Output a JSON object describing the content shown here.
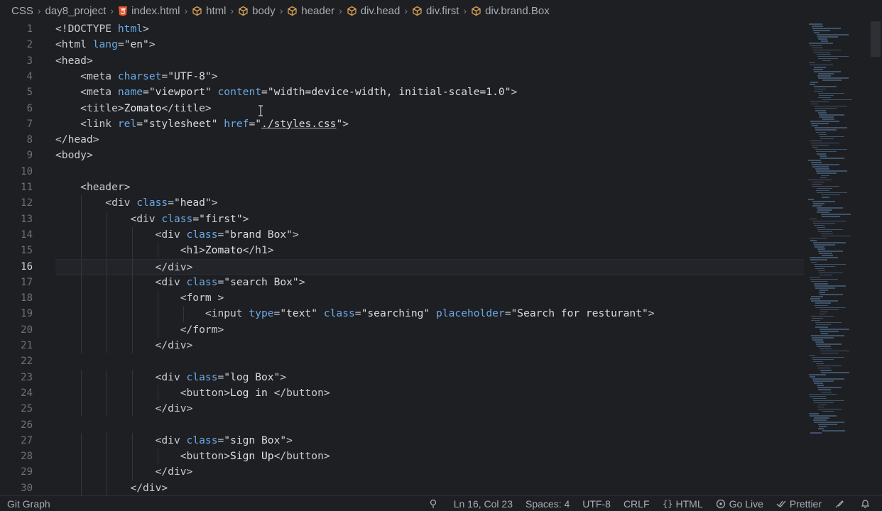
{
  "breadcrumb": {
    "items": [
      {
        "label": "CSS",
        "icon": ""
      },
      {
        "label": "day8_project",
        "icon": ""
      },
      {
        "label": "index.html",
        "icon": "html5-icon"
      },
      {
        "label": "html",
        "icon": "element-icon"
      },
      {
        "label": "body",
        "icon": "element-icon"
      },
      {
        "label": "header",
        "icon": "element-icon"
      },
      {
        "label": "div.head",
        "icon": "element-icon"
      },
      {
        "label": "div.first",
        "icon": "element-icon"
      },
      {
        "label": "div.brand.Box",
        "icon": "element-icon"
      }
    ],
    "html5_icon_color": "#e4572e",
    "element_icon_color": "#d9a257"
  },
  "editor": {
    "active_line": 16,
    "lines": [
      "<!DOCTYPE html>",
      "<html lang=\"en\">",
      "<head>",
      "    <meta charset=\"UTF-8\">",
      "    <meta name=\"viewport\" content=\"width=device-width, initial-scale=1.0\">",
      "    <title>Zomato</title>",
      "    <link rel=\"stylesheet\" href=\"./styles.css\">",
      "</head>",
      "<body>",
      "",
      "    <header>",
      "        <div class=\"head\">",
      "            <div class=\"first\">",
      "                <div class=\"brand Box\">",
      "                    <h1>Zomato</h1>",
      "                </div>",
      "                <div class=\"search Box\">",
      "                    <form >",
      "                        <input type=\"text\" class=\"searching\" placeholder=\"Search for resturant\">",
      "                    </form>",
      "                </div>",
      "",
      "                <div class=\"log Box\">",
      "                    <button>Log in </button>",
      "                </div>",
      "",
      "                <div class=\"sign Box\">",
      "                    <button>Sign Up</button>",
      "                </div>",
      "            </div>"
    ],
    "line_numbers": [
      "1",
      "2",
      "3",
      "4",
      "5",
      "6",
      "7",
      "8",
      "9",
      "10",
      "11",
      "12",
      "13",
      "14",
      "15",
      "16",
      "17",
      "18",
      "19",
      "20",
      "21",
      "22",
      "23",
      "24",
      "25",
      "26",
      "27",
      "28",
      "29",
      "30"
    ],
    "colors": {
      "attribute": "#6aa8e8",
      "tag": "#c8ccd4",
      "string": "#d8dadf"
    }
  },
  "statusbar": {
    "left": "Git Graph",
    "position": "Ln 16, Col 23",
    "spaces": "Spaces: 4",
    "encoding": "UTF-8",
    "eol": "CRLF",
    "language": "HTML",
    "go_live": "Go Live",
    "prettier": "Prettier"
  }
}
